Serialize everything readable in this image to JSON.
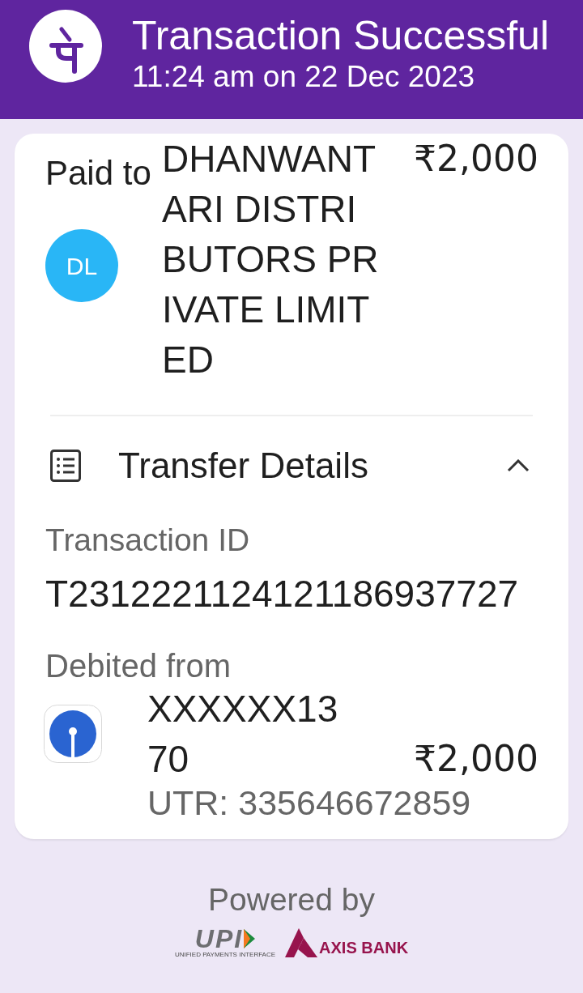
{
  "header": {
    "title": "Transaction Successful",
    "timestamp": "11:24 am on 22 Dec 2023"
  },
  "payee": {
    "label": "Paid to",
    "avatar_initials": "DL",
    "name": "DHANWANTARI DISTRIBUTORS PRIVATE LIMITED",
    "amount": "₹2,000"
  },
  "transfer_details": {
    "title": "Transfer Details",
    "expanded": true,
    "fields": [
      {
        "label": "Transaction ID",
        "value": "T2312221124121186937727"
      }
    ],
    "debit": {
      "label": "Debited from",
      "account": "XXXXXX1370",
      "amount": "₹2,000",
      "utr": "UTR: 335646672859"
    }
  },
  "footer": {
    "powered_by": "Powered by",
    "logos": [
      {
        "kind": "upi",
        "text": "UPI",
        "tagline": "UNIFIED PAYMENTS INTERFACE"
      },
      {
        "kind": "axis",
        "text": "AXIS BANK"
      }
    ]
  }
}
